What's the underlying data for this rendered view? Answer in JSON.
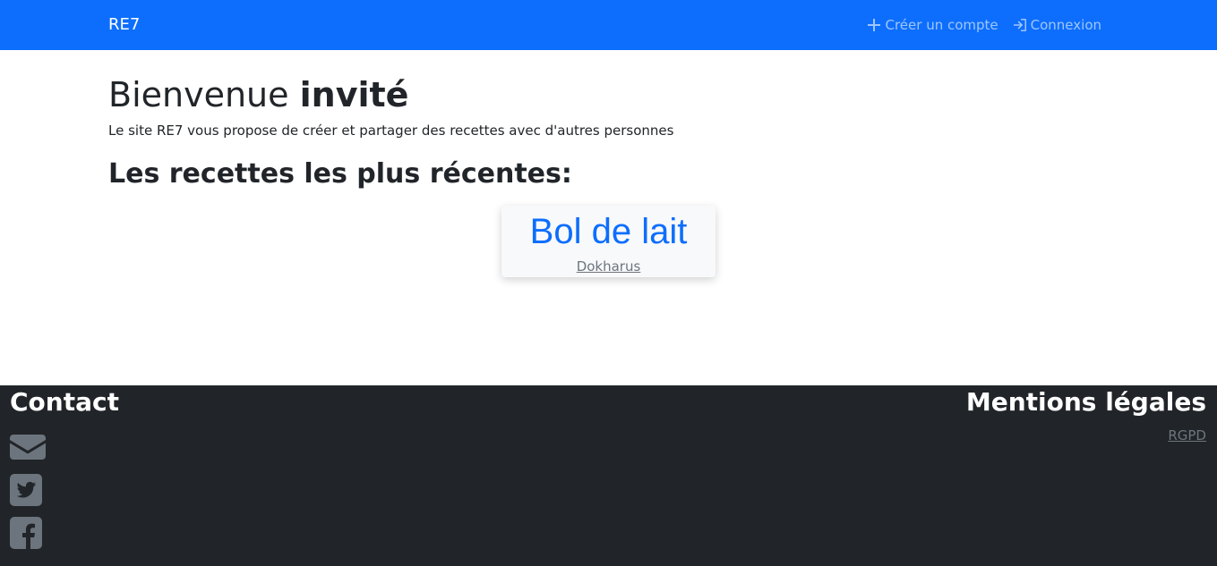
{
  "navbar": {
    "brand": "RE7",
    "links": [
      {
        "label": "Créer un compte",
        "icon": "plus-icon"
      },
      {
        "label": "Connexion",
        "icon": "login-icon"
      }
    ]
  },
  "main": {
    "title_prefix": "Bienvenue",
    "title_user": "invité",
    "subtitle": "Le site RE7 vous propose de créer et partager des recettes avec d'autres personnes",
    "recent_heading": "Les recettes les plus récentes:",
    "recipes": [
      {
        "title": "Bol de lait",
        "author": "Dokharus"
      }
    ]
  },
  "footer": {
    "contact_heading": "Contact",
    "contact_icons": [
      "envelope-icon",
      "twitter-icon",
      "facebook-icon"
    ],
    "legal_heading": "Mentions légales",
    "legal_link": "RGPD"
  },
  "colors": {
    "primary": "#0d6efd",
    "footer_bg": "#212529",
    "muted": "#6c757d",
    "card_bg": "#f8f9fa"
  }
}
